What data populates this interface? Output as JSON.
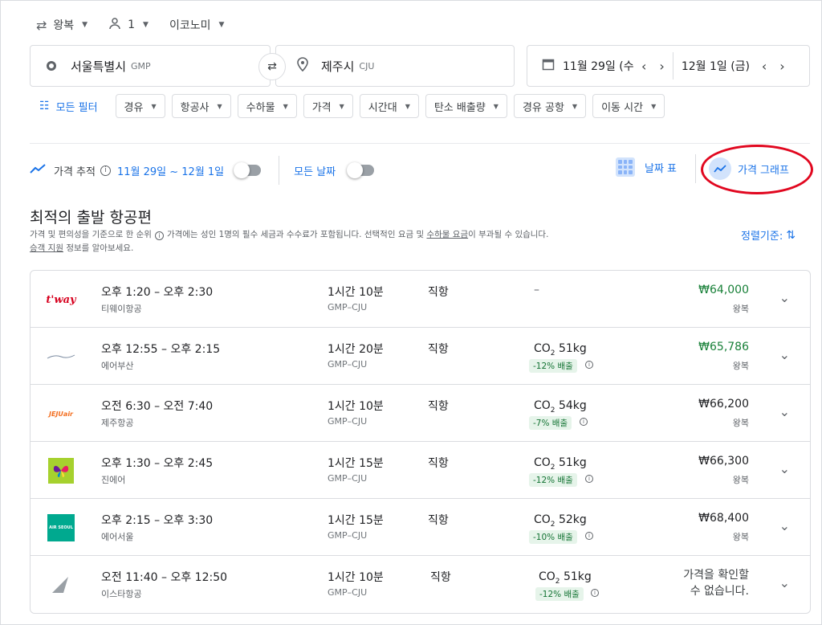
{
  "top_options": {
    "trip_type": "왕복",
    "passengers": "1",
    "cabin": "이코노미"
  },
  "search": {
    "origin_city": "서울특별시",
    "origin_code": "GMP",
    "dest_city": "제주시",
    "dest_code": "CJU",
    "depart_date": "11월 29일 (수",
    "return_date": "12월 1일 (금)"
  },
  "filters": {
    "all_filters": "모든 필터",
    "chips": [
      "경유",
      "항공사",
      "수하물",
      "가격",
      "시간대",
      "탄소 배출량",
      "경유 공항",
      "이동 시간"
    ]
  },
  "tracking": {
    "label": "가격 추적",
    "range": "11월 29일 ~ 12월 1일",
    "all_dates": "모든 날짜",
    "date_grid": "날짜 표",
    "price_graph": "가격 그래프"
  },
  "results": {
    "title": "최적의 출발 항공편",
    "note_part1": "가격 및 편의성을 기준으로 한 순위",
    "note_part2": "가격에는 성인 1명의 필수 세금과 수수료가 포함됩니다. 선택적인 요금 및",
    "note_link1": "수하물 요금",
    "note_part3": "이 부과될 수 있습니다.",
    "note_link2": "승객 지원",
    "note_part4": "정보를 알아보세요.",
    "sort_label": "정렬기준:"
  },
  "flights": [
    {
      "times": "오후 1:20 – 오후 2:30",
      "airline": "티웨이항공",
      "duration": "1시간 10분",
      "route": "GMP–CJU",
      "stops": "직항",
      "co2": "",
      "co2_badge": "",
      "price": "₩64,000",
      "price_type": "왕복",
      "logo_text": "t'way"
    },
    {
      "times": "오후 12:55 – 오후 2:15",
      "airline": "에어부산",
      "duration": "1시간 20분",
      "route": "GMP–CJU",
      "stops": "직항",
      "co2": "51kg",
      "co2_badge": "-12% 배출",
      "price": "₩65,786",
      "price_type": "왕복",
      "logo_text": ""
    },
    {
      "times": "오전 6:30 – 오전 7:40",
      "airline": "제주항공",
      "duration": "1시간 10분",
      "route": "GMP–CJU",
      "stops": "직항",
      "co2": "54kg",
      "co2_badge": "-7% 배출",
      "price": "₩66,200",
      "price_type": "왕복",
      "logo_text": "JEJUair"
    },
    {
      "times": "오후 1:30 – 오후 2:45",
      "airline": "진에어",
      "duration": "1시간 15분",
      "route": "GMP–CJU",
      "stops": "직항",
      "co2": "51kg",
      "co2_badge": "-12% 배출",
      "price": "₩66,300",
      "price_type": "왕복",
      "logo_text": ""
    },
    {
      "times": "오후 2:15 – 오후 3:30",
      "airline": "에어서울",
      "duration": "1시간 15분",
      "route": "GMP–CJU",
      "stops": "직항",
      "co2": "52kg",
      "co2_badge": "-10% 배출",
      "price": "₩68,400",
      "price_type": "왕복",
      "logo_text": "AIR SEOUL"
    },
    {
      "times": "오전 11:40 – 오후 12:50",
      "airline": "이스타항공",
      "duration": "1시간 10분",
      "route": "GMP–CJU",
      "stops": "직항",
      "co2": "51kg",
      "co2_badge": "-12% 배출",
      "price": "",
      "price_type": "",
      "unavailable": "가격을 확인할\n수 없습니다.",
      "logo_text": ""
    }
  ],
  "placeholder_dash": "–",
  "co2_prefix": "CO",
  "co2_sub": "2",
  "colors": {
    "accent": "#1a73e8",
    "price_green": "#188038",
    "badge_green": "#e6f4ea",
    "highlight_red": "#e1071f"
  }
}
